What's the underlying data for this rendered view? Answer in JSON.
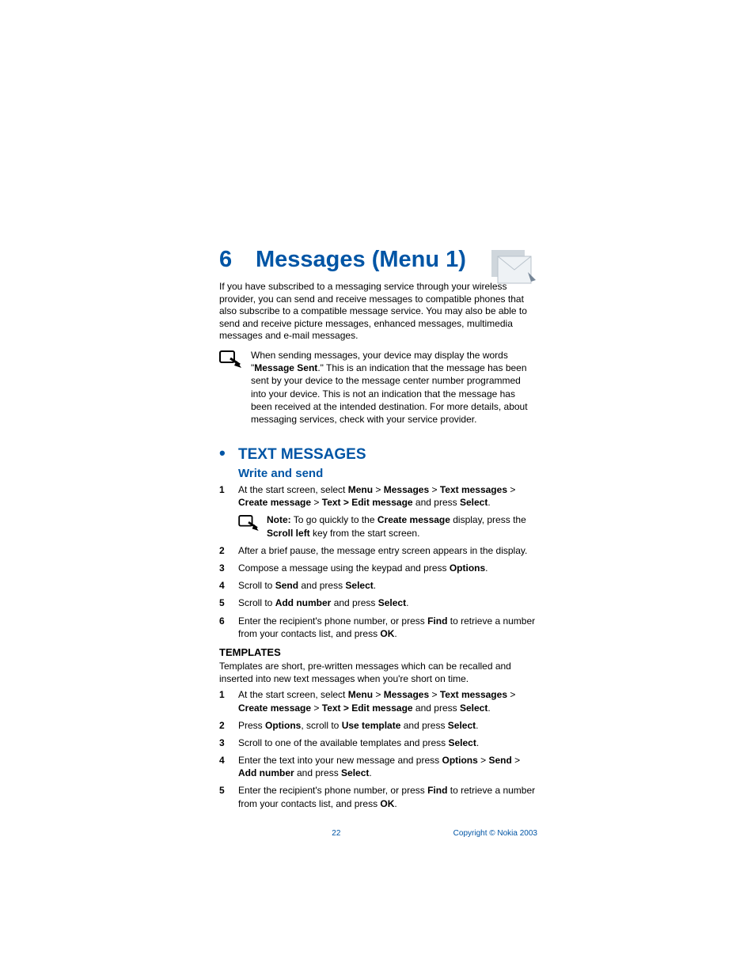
{
  "chapter": {
    "num": "6",
    "title": "Messages (Menu 1)"
  },
  "intro": "If you have subscribed to a messaging service through your wireless provider, you can send and receive messages to compatible phones that also subscribe to a compatible message service. You may also be able to send and receive picture messages, enhanced messages, multimedia messages and e-mail messages.",
  "note1_a": "When sending messages, your device may display the words \"",
  "note1_b": "Message Sent",
  "note1_c": ".\" This is an indication that the message has been sent by your device to the message center number programmed into your device. This is not an indication that the message has been received at the intended destination. For more details, about messaging services, check with your service provider.",
  "section": "TEXT MESSAGES",
  "subsection": "Write and send",
  "s1": {
    "n": "1",
    "t0": "At the start screen, select ",
    "t1": "Menu",
    "t2": " > ",
    "t3": "Messages",
    "t4": " > ",
    "t5": "Text messages",
    "t6": " > ",
    "t7": "Create message",
    "t8": " > ",
    "t9": "Text > Edit message",
    "t10": " and press ",
    "t11": "Select",
    "t12": "."
  },
  "innernote": {
    "a": "Note:",
    "b": " To go quickly to the ",
    "c": "Create message",
    "d": " display, press the ",
    "e": "Scroll left",
    "f": " key from the start screen."
  },
  "s2": {
    "n": "2",
    "t": "After a brief pause, the message entry screen appears in the display."
  },
  "s3": {
    "n": "3",
    "t0": "Compose a message using the keypad and press ",
    "t1": "Options",
    "t2": "."
  },
  "s4": {
    "n": "4",
    "t0": "Scroll to ",
    "t1": "Send",
    "t2": " and press ",
    "t3": "Select",
    "t4": "."
  },
  "s5": {
    "n": "5",
    "t0": "Scroll to ",
    "t1": "Add number",
    "t2": " and press ",
    "t3": "Select",
    "t4": "."
  },
  "s6": {
    "n": "6",
    "t0": "Enter the recipient's phone number, or press ",
    "t1": "Find",
    "t2": " to retrieve a number from your contacts list, and press ",
    "t3": "OK",
    "t4": "."
  },
  "templates_head": "TEMPLATES",
  "templates_intro": "Templates are short, pre-written messages which can be recalled and inserted into new text messages when you're short on time.",
  "t1r": {
    "n": "1",
    "t0": "At the start screen, select ",
    "t1": "Menu",
    "t2": " > ",
    "t3": "Messages",
    "t4": " > ",
    "t5": "Text messages",
    "t6": " > ",
    "t7": "Create message",
    "t8": " > ",
    "t9": "Text > Edit message",
    "t10": " and press ",
    "t11": "Select",
    "t12": "."
  },
  "t2r": {
    "n": "2",
    "t0": "Press ",
    "t1": "Options",
    "t2": ", scroll to ",
    "t3": "Use template",
    "t4": " and press ",
    "t5": "Select",
    "t6": "."
  },
  "t3r": {
    "n": "3",
    "t0": "Scroll to one of the available templates and press ",
    "t1": "Select",
    "t2": "."
  },
  "t4r": {
    "n": "4",
    "t0": "Enter the text into your new message and press ",
    "t1": "Options",
    "t2": " > ",
    "t3": "Send",
    "t4": " > ",
    "t5": "Add number",
    "t6": " and press ",
    "t7": "Select",
    "t8": "."
  },
  "t5r": {
    "n": "5",
    "t0": "Enter the recipient's phone number, or press ",
    "t1": "Find",
    "t2": " to retrieve a number from your contacts list, and press ",
    "t3": "OK",
    "t4": "."
  },
  "footer": {
    "page": "22",
    "copyright": "Copyright © Nokia 2003"
  }
}
